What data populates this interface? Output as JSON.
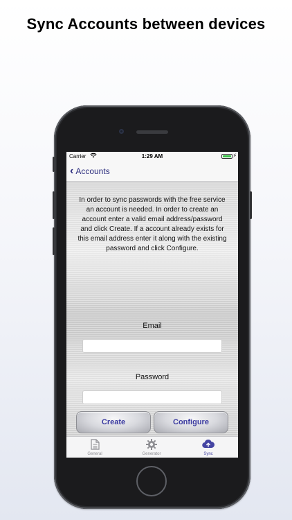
{
  "headline": "Sync Accounts between devices",
  "status_bar": {
    "carrier": "Carrier",
    "time": "1:29 AM",
    "battery_color": "#3cc24a"
  },
  "nav": {
    "back_label": "Accounts"
  },
  "main": {
    "intro_text": "In order to sync passwords with the free service an account is needed. In order to create an account enter a valid email address/password and click Create. If a account already exists for this email address enter it along with the existing password and click Configure.",
    "email_label": "Email",
    "email_value": "",
    "password_label": "Password",
    "password_value": "",
    "create_label": "Create",
    "configure_label": "Configure",
    "button_text_color": "#3a3aa0"
  },
  "tabbar": {
    "tabs": [
      {
        "label": "General",
        "icon": "document-icon",
        "active": false
      },
      {
        "label": "Generator",
        "icon": "gear-icon",
        "active": false
      },
      {
        "label": "Sync",
        "icon": "cloud-upload-icon",
        "active": true
      }
    ],
    "active_color": "#4545a3",
    "inactive_color": "#8e8e93"
  }
}
